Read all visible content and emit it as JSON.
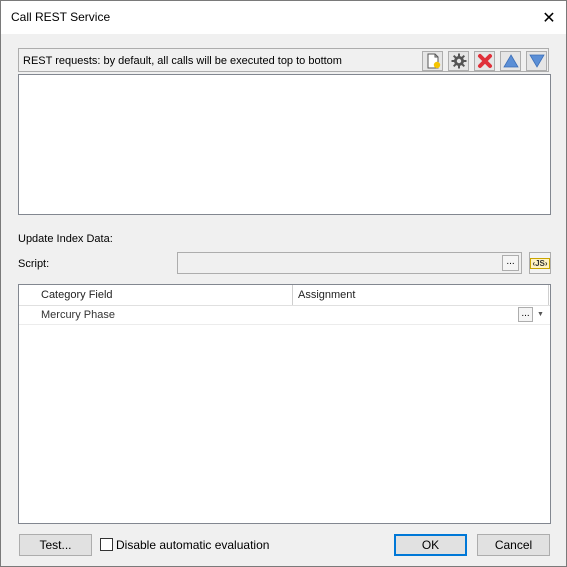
{
  "window": {
    "title": "Call REST Service",
    "close_glyph": "✕"
  },
  "requests": {
    "header_label": "REST requests: by default, all calls will be executed top to bottom",
    "toolbar_icons": [
      "new-document-icon",
      "gear-icon",
      "delete-icon",
      "arrow-up-icon",
      "arrow-down-icon"
    ]
  },
  "update_index": {
    "label": "Update Index Data:",
    "script_label": "Script:",
    "script_value": "",
    "browse_label": "...",
    "js_label": "‹JS›"
  },
  "grid": {
    "columns": [
      "Category Field",
      "Assignment"
    ],
    "rows": [
      {
        "category": "Mercury Phase",
        "assignment": "",
        "browse": "...",
        "dropdown": "▼"
      }
    ]
  },
  "footer": {
    "test_label": "Test...",
    "checkbox_label": "Disable automatic evaluation",
    "checkbox_checked": false,
    "ok_label": "OK",
    "cancel_label": "Cancel"
  },
  "colors": {
    "delete": "#e0303a",
    "arrow": "#5b8fd6",
    "default_button_border": "#0078d7"
  }
}
